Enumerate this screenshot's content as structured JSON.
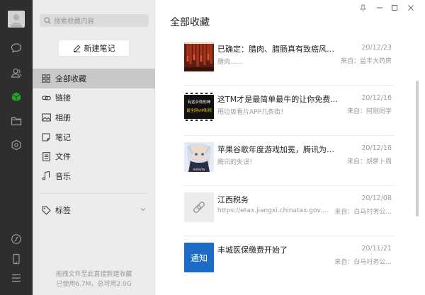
{
  "rail": {
    "icons": [
      "avatar",
      "chat-icon",
      "contacts-icon",
      "favorites-cube-icon",
      "folder-icon",
      "settings-icon",
      "mini-program-icon",
      "phone-icon",
      "menu-icon"
    ],
    "active_color": "#1aad19"
  },
  "sidebar": {
    "search_placeholder": "搜索收藏内容",
    "new_note_label": "新建笔记",
    "items": [
      {
        "label": "全部收藏",
        "icon": "grid-icon",
        "active": true
      },
      {
        "label": "链接",
        "icon": "link-icon"
      },
      {
        "label": "相册",
        "icon": "image-icon"
      },
      {
        "label": "笔记",
        "icon": "note-icon"
      },
      {
        "label": "文件",
        "icon": "file-icon"
      },
      {
        "label": "音乐",
        "icon": "music-icon"
      }
    ],
    "tags_label": "标签",
    "footer_hint": "拖拽文件至此直接新建收藏",
    "storage_text": "已使用6.7M，总可用2.0G"
  },
  "main": {
    "title": "全部收藏",
    "items": [
      {
        "title": "已确定：腊肉、腊肠真有致癌风险...",
        "date": "20/12/23",
        "desc": "腊肉......",
        "source": "来自：益丰大药房",
        "thumb": "food"
      },
      {
        "title": "这TM才是最简单最牛的让你免费...",
        "date": "20/12/16",
        "desc": "甩垃圾看片APP几条街！",
        "source": "来自：阿刚同学",
        "thumb": "video",
        "thumb_text_1": "有这合你的神",
        "thumb_text_2": "最全网VIP影视"
      },
      {
        "title": "苹果谷歌年度游戏加冕，腾讯为啥...",
        "date": "20/12/16",
        "desc": "腾讯的失误！",
        "source": "来自：胡萝卜周",
        "thumb": "anime",
        "thumb_text": "miHoYo"
      },
      {
        "title": "江西税务",
        "date": "20/12/08",
        "desc": "https://etax.jiangxi.chinatax.gov.cn/eta...",
        "source": "来自：白马村务公...",
        "thumb": "link"
      },
      {
        "title": "丰城医保缴费开始了",
        "date": "20/11/21",
        "desc": "",
        "source": "来自：白马村务公...",
        "thumb": "notice",
        "thumb_text": "通知"
      }
    ]
  }
}
